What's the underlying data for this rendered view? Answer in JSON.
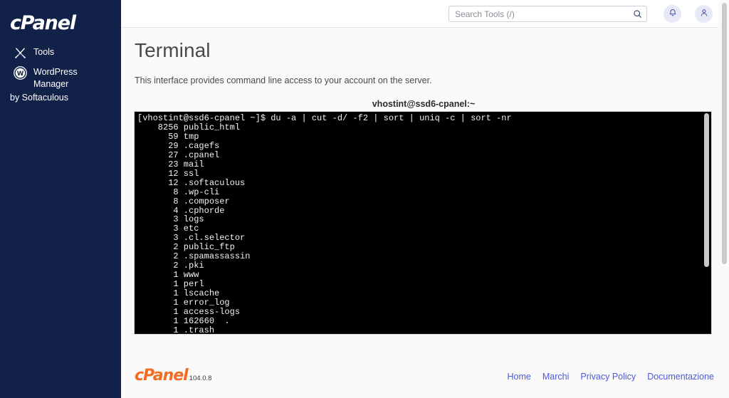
{
  "sidebar": {
    "brand": "cPanel",
    "items": [
      {
        "label": "Tools",
        "icon": "tools-icon"
      },
      {
        "label": "WordPress Manager",
        "sub": "by Softaculous",
        "icon": "wordpress-icon"
      }
    ]
  },
  "header": {
    "search": {
      "placeholder": "Search Tools (/)",
      "value": "",
      "icon": "search-icon"
    },
    "notifications_icon": "bell-icon",
    "account_icon": "user-icon"
  },
  "main": {
    "title": "Terminal",
    "description": "This interface provides command line access to your account on the server.",
    "terminal": {
      "title": "vhostint@ssd6-cpanel:~",
      "prompt_line": "[vhostint@ssd6-cpanel ~]$ du -a | cut -d/ -f2 | sort | uniq -c | sort -nr",
      "output": [
        {
          "count": "8256",
          "name": "public_html"
        },
        {
          "count": "59",
          "name": "tmp"
        },
        {
          "count": "29",
          "name": ".cagefs"
        },
        {
          "count": "27",
          "name": ".cpanel"
        },
        {
          "count": "23",
          "name": "mail"
        },
        {
          "count": "12",
          "name": "ssl"
        },
        {
          "count": "12",
          "name": ".softaculous"
        },
        {
          "count": "8",
          "name": ".wp-cli"
        },
        {
          "count": "8",
          "name": ".composer"
        },
        {
          "count": "4",
          "name": ".cphorde"
        },
        {
          "count": "3",
          "name": "logs"
        },
        {
          "count": "3",
          "name": "etc"
        },
        {
          "count": "3",
          "name": ".cl.selector"
        },
        {
          "count": "2",
          "name": "public_ftp"
        },
        {
          "count": "2",
          "name": ".spamassassin"
        },
        {
          "count": "2",
          "name": ".pki"
        },
        {
          "count": "1",
          "name": "www"
        },
        {
          "count": "1",
          "name": "perl"
        },
        {
          "count": "1",
          "name": "lscache"
        },
        {
          "count": "1",
          "name": "error_log"
        },
        {
          "count": "1",
          "name": "access-logs"
        },
        {
          "count": "1",
          "name": "162660  ."
        },
        {
          "count": "1",
          "name": ".trash"
        }
      ]
    }
  },
  "footer": {
    "brand": "cPanel",
    "version": "104.0.8",
    "links": [
      {
        "label": "Home"
      },
      {
        "label": "Marchi"
      },
      {
        "label": "Privacy Policy"
      },
      {
        "label": "Documentazione"
      }
    ]
  },
  "colors": {
    "sidebar_bg": "#112148",
    "accent_orange": "#f26c22",
    "link_blue": "#4a5ad6",
    "terminal_bg": "#000000",
    "content_bg": "#fafafa"
  }
}
